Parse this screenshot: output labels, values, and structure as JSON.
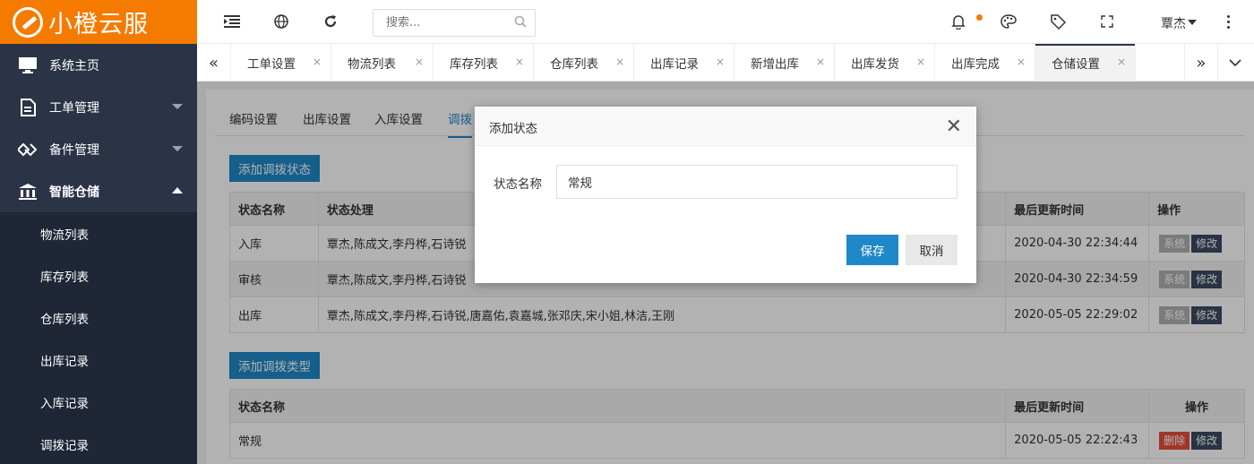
{
  "app": {
    "logo_text": "小橙云服"
  },
  "sidebar": {
    "items": [
      {
        "label": "系统主页",
        "icon": "monitor-icon"
      },
      {
        "label": "工单管理",
        "icon": "document-icon"
      },
      {
        "label": "备件管理",
        "icon": "diamond-icon"
      },
      {
        "label": "智能仓储",
        "icon": "bank-icon"
      }
    ],
    "submenu": [
      "物流列表",
      "库存列表",
      "仓库列表",
      "出库记录",
      "入库记录",
      "调拨记录"
    ]
  },
  "header": {
    "search_placeholder": "搜索...",
    "user_name": "覃杰",
    "accent": "#f57a00"
  },
  "tabs": {
    "items": [
      "工单设置",
      "物流列表",
      "库存列表",
      "仓库列表",
      "出库记录",
      "新增出库",
      "出库发货",
      "出库完成",
      "仓储设置"
    ],
    "active": "仓储设置",
    "prev": "«",
    "next": "»",
    "close": "×"
  },
  "page": {
    "subtabs": [
      "编码设置",
      "出库设置",
      "入库设置",
      "调拨"
    ],
    "add_status_btn": "添加调拨状态",
    "add_type_btn": "添加调拨类型",
    "status_table": {
      "headers": [
        "状态名称",
        "状态处理",
        "最后更新时间",
        "操作"
      ],
      "rows": [
        {
          "name": "入库",
          "handlers": "覃杰,陈成文,李丹桦,石诗锐",
          "updated": "2020-04-30 22:34:44"
        },
        {
          "name": "审核",
          "handlers": "覃杰,陈成文,李丹桦,石诗锐",
          "updated": "2020-04-30 22:34:59"
        },
        {
          "name": "出库",
          "handlers": "覃杰,陈成文,李丹桦,石诗锐,唐嘉佑,袁嘉城,张邓庆,宋小姐,林洁,王刚",
          "updated": "2020-05-05 22:29:02"
        }
      ],
      "btn_system": "系统",
      "btn_edit": "修改"
    },
    "type_table": {
      "headers": [
        "状态名称",
        "最后更新时间",
        "操作"
      ],
      "rows": [
        {
          "name": "常规",
          "updated": "2020-05-05 22:22:43"
        }
      ],
      "btn_delete": "删除",
      "btn_edit": "修改"
    }
  },
  "dialog": {
    "title": "添加状态",
    "close": "✕",
    "field_label": "状态名称",
    "field_value": "常规",
    "save": "保存",
    "cancel": "取消"
  }
}
